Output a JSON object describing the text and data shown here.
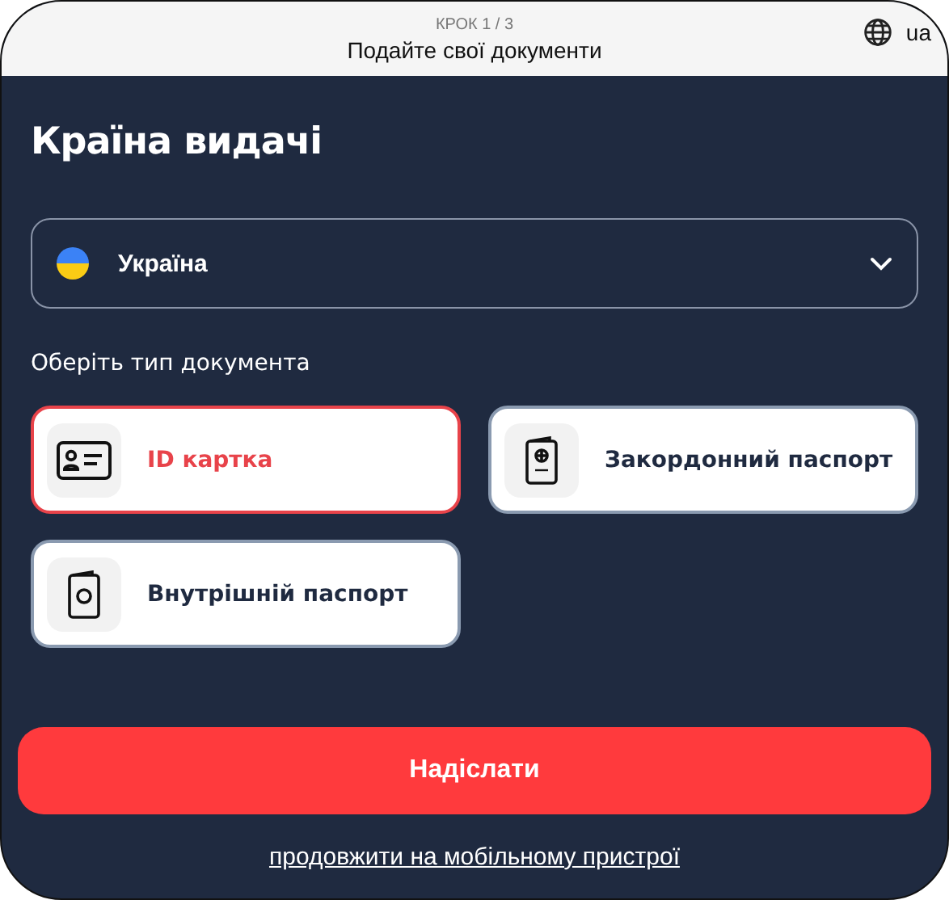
{
  "header": {
    "step": "КРОК 1 / 3",
    "title": "Подайте свої документи",
    "language": "ua"
  },
  "country_section": {
    "title": "Країна видачі",
    "country": {
      "name": "Україна"
    }
  },
  "document_section": {
    "label": "Оберіть тип документа",
    "documents": [
      {
        "kind": "id-card",
        "label": "ID картка",
        "selected": true
      },
      {
        "kind": "passport",
        "label": "Закордонний паспорт",
        "selected": false
      },
      {
        "kind": "internal-passport",
        "label": "Внутрішній паспорт",
        "selected": false
      }
    ]
  },
  "submit_button": "Надіслати",
  "mobile_link": "продовжити на мобільному пристрої"
}
